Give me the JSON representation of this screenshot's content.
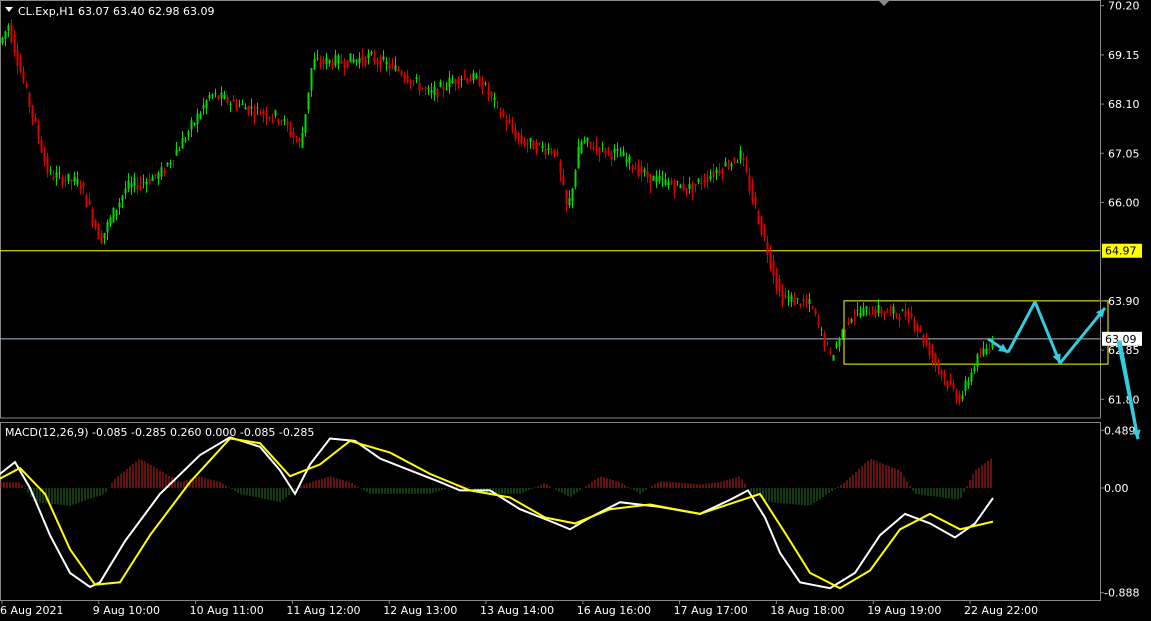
{
  "header": {
    "symbol_line": "CL.Exp,H1  63.07 63.40 62.98 63.09",
    "macd_line": "MACD(12,26,9) -0.085 -0.285 0.260 0.000 -0.085 -0.285"
  },
  "price_axis": {
    "ticks": [
      "70.20",
      "69.15",
      "68.10",
      "67.05",
      "66.00",
      "64.97",
      "63.90",
      "63.09",
      "62.85",
      "61.80"
    ],
    "tick_values": [
      70.2,
      69.15,
      68.1,
      67.05,
      66.0,
      64.97,
      63.9,
      63.09,
      62.85,
      61.8
    ],
    "range": [
      61.4,
      70.3
    ],
    "tag_levels": {
      "yellow": 64.97,
      "current": 63.09
    }
  },
  "macd_axis": {
    "ticks": [
      "0.489",
      "0.00",
      "-0.888"
    ],
    "tick_values": [
      0.489,
      0.0,
      -0.888
    ],
    "range": [
      -0.95,
      0.56
    ]
  },
  "time_axis": {
    "labels": [
      "6 Aug 2021",
      "9 Aug 10:00",
      "10 Aug 11:00",
      "11 Aug 12:00",
      "12 Aug 13:00",
      "13 Aug 14:00",
      "16 Aug 16:00",
      "17 Aug 17:00",
      "18 Aug 18:00",
      "19 Aug 19:00",
      "22 Aug 22:00"
    ]
  },
  "colors": {
    "background": "#000000",
    "bull_candle": "#00dd00",
    "bear_candle": "#dd0000",
    "level_line": "#ffff00",
    "current_line": "#aabbcc",
    "forecast_arrow": "#33ccdd",
    "macd_line": "#ffffff",
    "signal_line": "#ffff00",
    "hist_positive": "#cc2222",
    "hist_negative": "#227722",
    "axis_text": "#ffffff"
  },
  "chart_data": {
    "type": "candlestick",
    "symbol": "CL.Exp",
    "timeframe": "H1",
    "last_bar": {
      "open": 63.07,
      "high": 63.4,
      "low": 62.98,
      "close": 63.09
    },
    "close_path": [
      [
        0,
        69.4
      ],
      [
        8,
        69.8
      ],
      [
        20,
        68.8
      ],
      [
        48,
        66.6
      ],
      [
        80,
        66.4
      ],
      [
        100,
        65.2
      ],
      [
        125,
        66.3
      ],
      [
        160,
        66.6
      ],
      [
        185,
        67.4
      ],
      [
        210,
        68.3
      ],
      [
        250,
        68.0
      ],
      [
        280,
        67.8
      ],
      [
        300,
        67.2
      ],
      [
        312,
        69.0
      ],
      [
        340,
        69.0
      ],
      [
        370,
        69.1
      ],
      [
        400,
        68.8
      ],
      [
        430,
        68.3
      ],
      [
        460,
        68.7
      ],
      [
        480,
        68.6
      ],
      [
        500,
        67.9
      ],
      [
        520,
        67.3
      ],
      [
        555,
        67.1
      ],
      [
        567,
        65.8
      ],
      [
        580,
        67.3
      ],
      [
        620,
        67.0
      ],
      [
        650,
        66.5
      ],
      [
        690,
        66.3
      ],
      [
        710,
        66.6
      ],
      [
        740,
        67.0
      ],
      [
        760,
        65.5
      ],
      [
        780,
        64.0
      ],
      [
        810,
        63.8
      ],
      [
        830,
        62.7
      ],
      [
        850,
        63.6
      ],
      [
        870,
        63.7
      ],
      [
        910,
        63.6
      ],
      [
        930,
        62.8
      ],
      [
        945,
        62.2
      ],
      [
        960,
        61.8
      ],
      [
        975,
        62.6
      ],
      [
        995,
        63.09
      ]
    ],
    "levels": [
      64.97,
      63.09
    ],
    "consolidation_box": {
      "price_top": 63.9,
      "price_bottom": 62.55
    },
    "forecast_path": [
      [
        988,
        63.09
      ],
      [
        1008,
        62.8
      ],
      [
        1035,
        63.88
      ],
      [
        1060,
        62.57
      ],
      [
        1105,
        63.75
      ],
      [
        1120,
        63.05
      ],
      [
        1138,
        60.95
      ]
    ],
    "macd": {
      "params": "12,26,9",
      "values": {
        "macd": -0.085,
        "signal": -0.285,
        "histogram": 0.26
      },
      "macd_path": [
        [
          0,
          0.12
        ],
        [
          15,
          0.22
        ],
        [
          30,
          0.0
        ],
        [
          50,
          -0.4
        ],
        [
          70,
          -0.72
        ],
        [
          90,
          -0.84
        ],
        [
          100,
          -0.8
        ],
        [
          125,
          -0.45
        ],
        [
          160,
          -0.05
        ],
        [
          200,
          0.28
        ],
        [
          230,
          0.43
        ],
        [
          260,
          0.35
        ],
        [
          280,
          0.15
        ],
        [
          295,
          -0.05
        ],
        [
          310,
          0.2
        ],
        [
          330,
          0.42
        ],
        [
          355,
          0.4
        ],
        [
          380,
          0.25
        ],
        [
          410,
          0.15
        ],
        [
          440,
          0.05
        ],
        [
          460,
          -0.02
        ],
        [
          490,
          -0.02
        ],
        [
          520,
          -0.18
        ],
        [
          550,
          -0.28
        ],
        [
          570,
          -0.35
        ],
        [
          590,
          -0.25
        ],
        [
          620,
          -0.12
        ],
        [
          660,
          -0.16
        ],
        [
          700,
          -0.22
        ],
        [
          730,
          -0.1
        ],
        [
          748,
          -0.02
        ],
        [
          765,
          -0.25
        ],
        [
          780,
          -0.55
        ],
        [
          800,
          -0.8
        ],
        [
          830,
          -0.85
        ],
        [
          855,
          -0.72
        ],
        [
          880,
          -0.4
        ],
        [
          905,
          -0.22
        ],
        [
          930,
          -0.3
        ],
        [
          955,
          -0.42
        ],
        [
          975,
          -0.3
        ],
        [
          993,
          -0.085
        ]
      ],
      "signal_path": [
        [
          0,
          0.08
        ],
        [
          20,
          0.17
        ],
        [
          45,
          -0.05
        ],
        [
          70,
          -0.52
        ],
        [
          95,
          -0.82
        ],
        [
          120,
          -0.8
        ],
        [
          150,
          -0.4
        ],
        [
          190,
          0.05
        ],
        [
          230,
          0.42
        ],
        [
          260,
          0.38
        ],
        [
          290,
          0.1
        ],
        [
          320,
          0.2
        ],
        [
          350,
          0.4
        ],
        [
          390,
          0.3
        ],
        [
          430,
          0.12
        ],
        [
          470,
          -0.02
        ],
        [
          510,
          -0.08
        ],
        [
          545,
          -0.25
        ],
        [
          575,
          -0.3
        ],
        [
          610,
          -0.18
        ],
        [
          650,
          -0.14
        ],
        [
          700,
          -0.22
        ],
        [
          735,
          -0.12
        ],
        [
          760,
          -0.05
        ],
        [
          785,
          -0.38
        ],
        [
          810,
          -0.72
        ],
        [
          840,
          -0.85
        ],
        [
          870,
          -0.7
        ],
        [
          900,
          -0.35
        ],
        [
          930,
          -0.22
        ],
        [
          960,
          -0.35
        ],
        [
          993,
          -0.285
        ]
      ],
      "hist_path": [
        [
          0,
          0.05
        ],
        [
          20,
          0.05
        ],
        [
          35,
          -0.12
        ],
        [
          70,
          -0.15
        ],
        [
          105,
          -0.05
        ],
        [
          115,
          0.08
        ],
        [
          140,
          0.25
        ],
        [
          160,
          0.15
        ],
        [
          180,
          0.05
        ],
        [
          200,
          0.1
        ],
        [
          220,
          0.05
        ],
        [
          240,
          -0.05
        ],
        [
          280,
          -0.12
        ],
        [
          300,
          0.02
        ],
        [
          330,
          0.1
        ],
        [
          350,
          0.05
        ],
        [
          370,
          -0.05
        ],
        [
          430,
          -0.05
        ],
        [
          460,
          0.03
        ],
        [
          490,
          -0.05
        ],
        [
          520,
          -0.05
        ],
        [
          545,
          0.04
        ],
        [
          570,
          -0.08
        ],
        [
          600,
          0.1
        ],
        [
          620,
          0.05
        ],
        [
          640,
          -0.05
        ],
        [
          660,
          0.06
        ],
        [
          700,
          0.03
        ],
        [
          720,
          0.05
        ],
        [
          740,
          0.1
        ],
        [
          752,
          -0.05
        ],
        [
          770,
          -0.12
        ],
        [
          810,
          -0.15
        ],
        [
          845,
          0.05
        ],
        [
          870,
          0.25
        ],
        [
          900,
          0.15
        ],
        [
          915,
          -0.05
        ],
        [
          960,
          -0.1
        ],
        [
          975,
          0.15
        ],
        [
          993,
          0.26
        ]
      ]
    }
  }
}
